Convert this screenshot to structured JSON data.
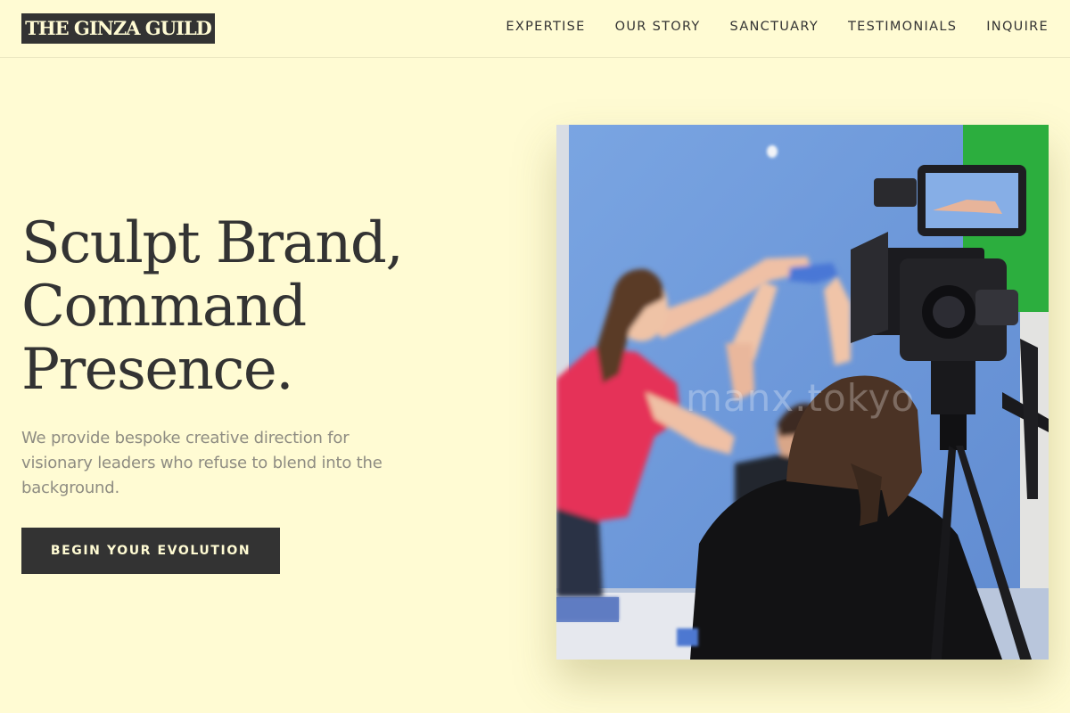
{
  "header": {
    "logo": "THE GINZA GUILD",
    "nav": [
      "EXPERTISE",
      "OUR STORY",
      "SANCTUARY",
      "TESTIMONIALS",
      "INQUIRE"
    ]
  },
  "hero": {
    "title_lines": [
      "Sculpt Brand,",
      "Command",
      "Presence."
    ],
    "subtitle": "We provide bespoke creative direction for visionary leaders who refuse to blend into the background.",
    "cta": "BEGIN YOUR EVOLUTION"
  },
  "photo": {
    "watermark": "manx.tokyo"
  },
  "colors": {
    "background": "#fffbd3",
    "ink": "#333333",
    "muted_text": "#8e8c82"
  }
}
